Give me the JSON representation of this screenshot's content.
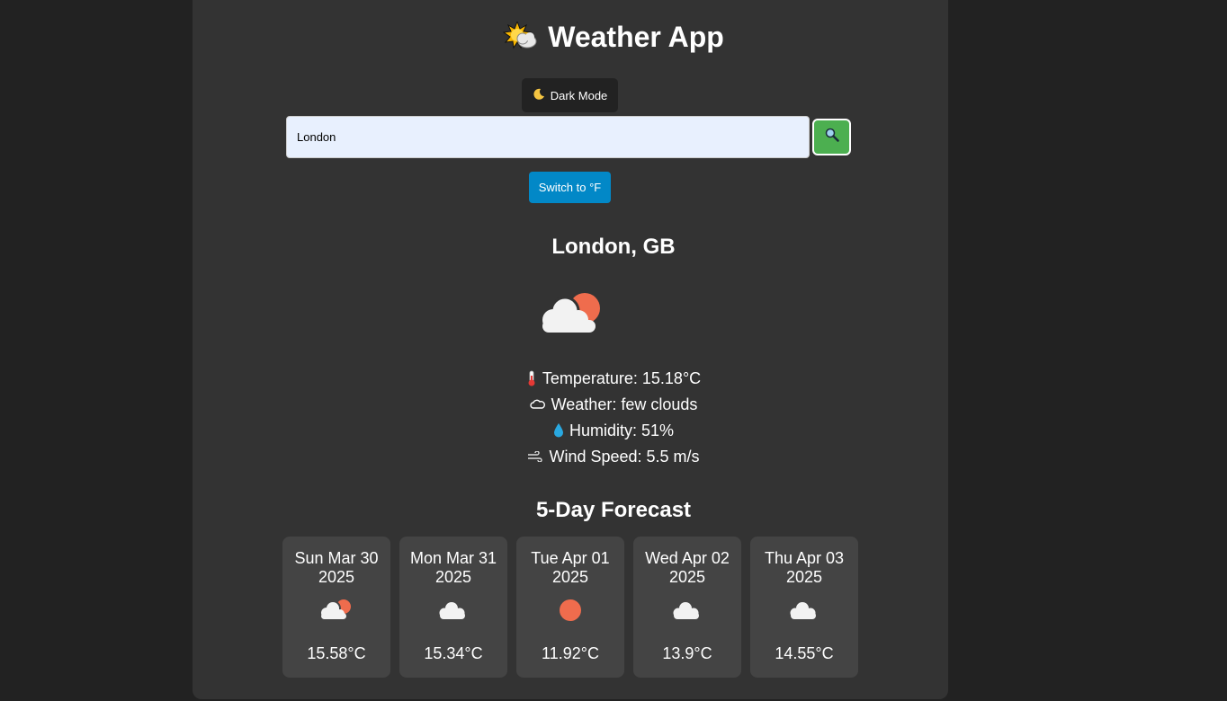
{
  "header": {
    "title": "Weather App",
    "title_icon": "sun-behind-cloud-icon"
  },
  "controls": {
    "dark_mode_label": "Dark Mode",
    "dark_mode_icon": "moon-icon",
    "search_value": "London",
    "search_icon": "magnifier-icon",
    "unit_toggle_label": "Switch to °F"
  },
  "current": {
    "city": "London, GB",
    "icon": "few-clouds-icon",
    "temperature": "Temperature: 15.18°C",
    "weather": "Weather: few clouds",
    "humidity": "Humidity: 51%",
    "wind": "Wind Speed: 5.5 m/s"
  },
  "forecast": {
    "title": "5-Day Forecast",
    "days": [
      {
        "day": "Sun Mar 30",
        "year": "2025",
        "temp": "15.58°C",
        "icon": "few-clouds-icon"
      },
      {
        "day": "Mon Mar 31",
        "year": "2025",
        "temp": "15.34°C",
        "icon": "cloud-icon"
      },
      {
        "day": "Tue Apr 01",
        "year": "2025",
        "temp": "11.92°C",
        "icon": "sun-icon"
      },
      {
        "day": "Wed Apr 02",
        "year": "2025",
        "temp": "13.9°C",
        "icon": "cloud-icon"
      },
      {
        "day": "Thu Apr 03",
        "year": "2025",
        "temp": "14.55°C",
        "icon": "cloud-icon"
      }
    ]
  },
  "colors": {
    "background": "#222222",
    "card": "#333333",
    "forecast_card": "#444444",
    "search_button": "#4caf50",
    "unit_button": "#0288c7",
    "sun": "#ef6c4d",
    "cloud": "#f2f2f2"
  }
}
